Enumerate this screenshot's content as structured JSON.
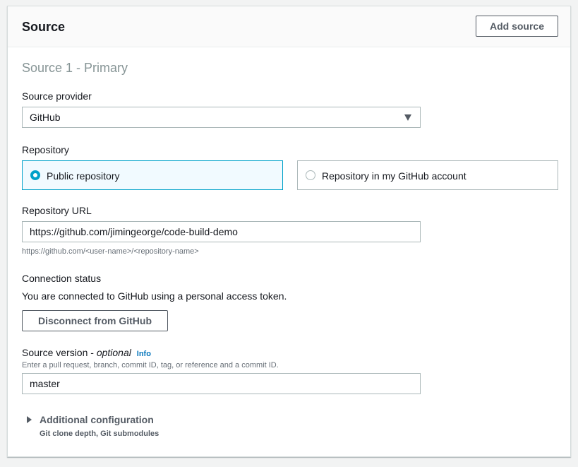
{
  "panel": {
    "title": "Source",
    "add_source_label": "Add source"
  },
  "source1": {
    "section_title": "Source 1 - Primary",
    "provider_label": "Source provider",
    "provider_value": "GitHub",
    "repository_label": "Repository",
    "repository_options": [
      {
        "label": "Public repository",
        "selected": true
      },
      {
        "label": "Repository in my GitHub account",
        "selected": false
      }
    ],
    "repo_url_label": "Repository URL",
    "repo_url_value": "https://github.com/jimingeorge/code-build-demo",
    "repo_url_hint": "https://github.com/<user-name>/<repository-name>",
    "connection_status_label": "Connection status",
    "connection_status_text": "You are connected to GitHub using a personal access token.",
    "disconnect_label": "Disconnect from GitHub",
    "source_version_label": "Source version - ",
    "source_version_optional": "optional",
    "info_label": "Info",
    "source_version_hint": "Enter a pull request, branch, commit ID, tag, or reference and a commit ID.",
    "source_version_value": "master",
    "additional_config_label": "Additional configuration",
    "additional_config_sub": "Git clone depth, Git submodules"
  },
  "icons": {
    "dropdown": "caret-down-icon",
    "expander": "caret-right-icon"
  },
  "colors": {
    "accent": "#00a1c9",
    "link": "#0073bb",
    "muted": "#879596"
  }
}
